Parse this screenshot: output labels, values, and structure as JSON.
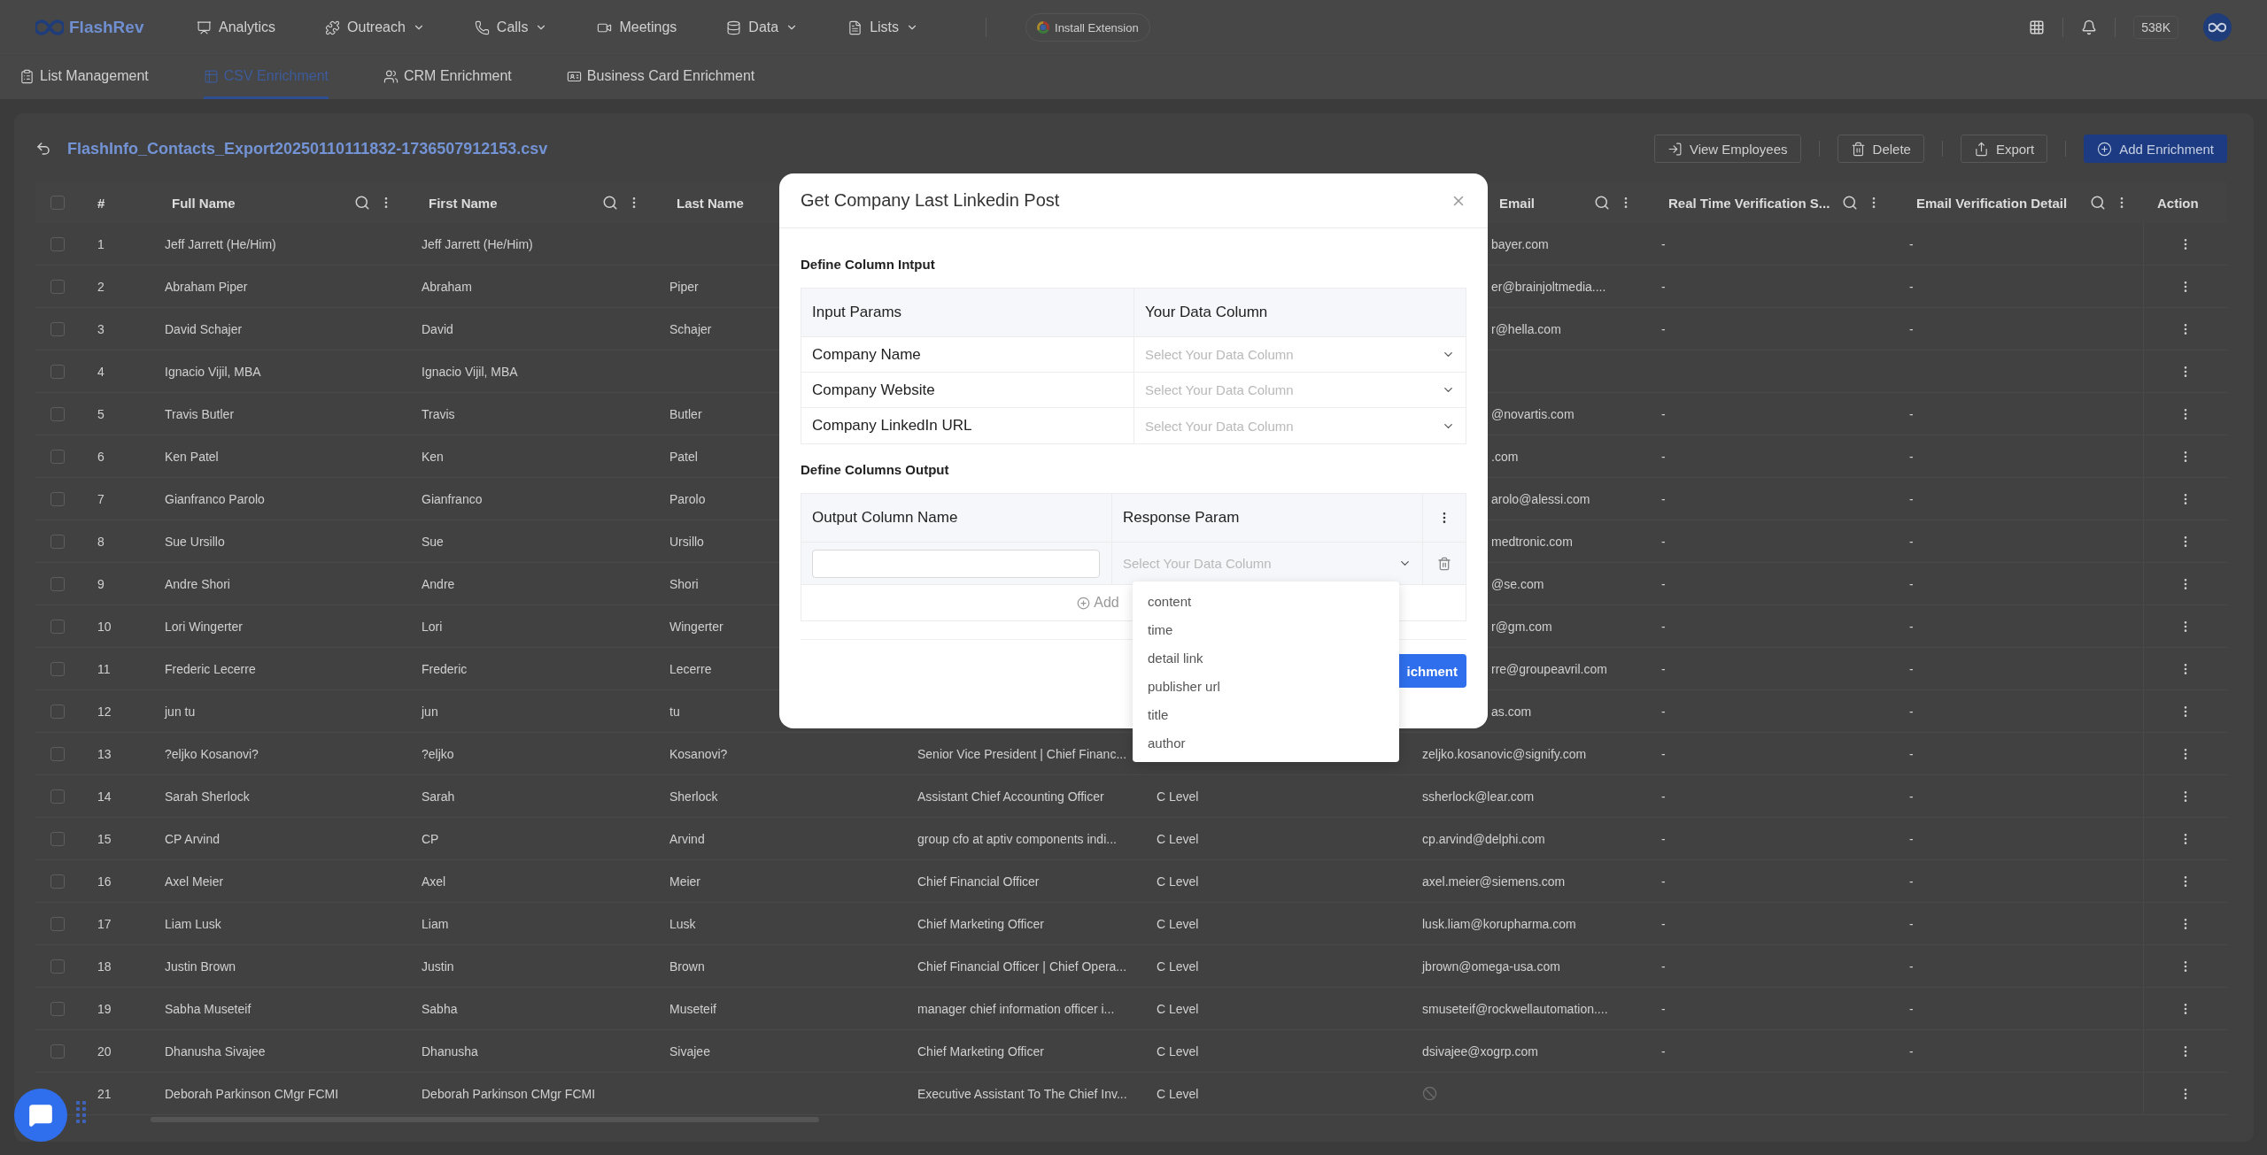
{
  "top_nav": {
    "logo": "FlashRev",
    "items": [
      {
        "label": "Analytics",
        "menu": false
      },
      {
        "label": "Outreach",
        "menu": true
      },
      {
        "label": "Calls",
        "menu": true
      },
      {
        "label": "Meetings",
        "menu": false
      },
      {
        "label": "Data",
        "menu": true
      },
      {
        "label": "Lists",
        "menu": true
      }
    ],
    "extension_button": "Install Extension",
    "credits": "538K"
  },
  "sub_tabs": [
    {
      "label": "List Management",
      "selected": false
    },
    {
      "label": "CSV Enrichment",
      "selected": true
    },
    {
      "label": "CRM Enrichment",
      "selected": false
    },
    {
      "label": "Business Card Enrichment",
      "selected": false
    }
  ],
  "file": {
    "title": "FlashInfo_Contacts_Export20250110111832-1736507912153.csv",
    "actions": [
      {
        "label": "View Employees",
        "kind": "outline"
      },
      {
        "label": "Delete",
        "kind": "outline"
      },
      {
        "label": "Export",
        "kind": "outline"
      },
      {
        "label": "Add Enrichment",
        "kind": "primary"
      }
    ]
  },
  "table": {
    "all_checked": false,
    "columns": [
      {
        "label": "#"
      },
      {
        "label": "Full Name",
        "tools": true
      },
      {
        "label": "First Name",
        "tools": true
      },
      {
        "label": "Last Name"
      },
      {
        "label": "Email",
        "tools": true
      },
      {
        "label": "Real Time Verification S...",
        "tools": true
      },
      {
        "label": "Email Verification Detail",
        "tools": true
      },
      {
        "label": "Action"
      }
    ],
    "rows": [
      {
        "checked": false,
        "no_email": false,
        "n": "1",
        "full_name": "Jeff Jarrett (He/Him)",
        "first_name": "Jeff Jarrett (He/Him)",
        "email": "bayer.com",
        "rtv": "-",
        "evd": "-"
      },
      {
        "checked": false,
        "no_email": false,
        "n": "2",
        "full_name": "Abraham Piper",
        "first_name": "Abraham",
        "last_name": "Piper",
        "email": "er@brainjoltmedia....",
        "rtv": "-",
        "evd": "-"
      },
      {
        "checked": false,
        "no_email": false,
        "n": "3",
        "full_name": "David Schajer",
        "first_name": "David",
        "last_name": "Schajer",
        "email": "r@hella.com",
        "rtv": "-",
        "evd": "-"
      },
      {
        "checked": false,
        "no_email": false,
        "n": "4",
        "full_name": "Ignacio Vijil, MBA",
        "first_name": "Ignacio Vijil, MBA"
      },
      {
        "checked": false,
        "no_email": false,
        "n": "5",
        "full_name": "Travis Butler",
        "first_name": "Travis",
        "last_name": "Butler",
        "email": "@novartis.com",
        "rtv": "-",
        "evd": "-"
      },
      {
        "checked": false,
        "no_email": false,
        "n": "6",
        "full_name": "Ken Patel",
        "first_name": "Ken",
        "last_name": "Patel",
        "email": ".com",
        "rtv": "-",
        "evd": "-"
      },
      {
        "checked": false,
        "no_email": false,
        "n": "7",
        "full_name": "Gianfranco Parolo",
        "first_name": "Gianfranco",
        "last_name": "Parolo",
        "email": "arolo@alessi.com",
        "rtv": "-",
        "evd": "-"
      },
      {
        "checked": false,
        "no_email": false,
        "n": "8",
        "full_name": "Sue Ursillo",
        "first_name": "Sue",
        "last_name": "Ursillo",
        "email": "medtronic.com",
        "rtv": "-",
        "evd": "-"
      },
      {
        "checked": false,
        "no_email": false,
        "n": "9",
        "full_name": "Andre Shori",
        "first_name": "Andre",
        "last_name": "Shori",
        "email": "@se.com",
        "rtv": "-",
        "evd": "-"
      },
      {
        "checked": false,
        "no_email": false,
        "n": "10",
        "full_name": "Lori Wingerter",
        "first_name": "Lori",
        "last_name": "Wingerter",
        "email": "r@gm.com",
        "rtv": "-",
        "evd": "-"
      },
      {
        "checked": false,
        "no_email": false,
        "n": "11",
        "full_name": "Frederic Lecerre",
        "first_name": "Frederic",
        "last_name": "Lecerre",
        "email": "rre@groupeavril.com",
        "rtv": "-",
        "evd": "-"
      },
      {
        "checked": false,
        "no_email": false,
        "n": "12",
        "full_name": "jun tu",
        "first_name": "jun",
        "last_name": "tu",
        "email": "as.com",
        "rtv": "-",
        "evd": "-"
      },
      {
        "checked": false,
        "no_email": false,
        "n": "13",
        "full_name": "?eljko Kosanovi?",
        "first_name": "?eljko",
        "last_name": "Kosanovi?",
        "job_title": "Senior Vice President | Chief Financ...",
        "email": "zeljko.kosanovic@signify.com",
        "rtv": "-",
        "evd": "-"
      },
      {
        "checked": false,
        "no_email": false,
        "n": "14",
        "full_name": "Sarah Sherlock",
        "first_name": "Sarah",
        "last_name": "Sherlock",
        "job_title": "Assistant Chief Accounting Officer",
        "level": "C Level",
        "email": "ssherlock@lear.com",
        "rtv": "-",
        "evd": "-"
      },
      {
        "checked": false,
        "no_email": false,
        "n": "15",
        "full_name": "CP Arvind",
        "first_name": "CP",
        "last_name": "Arvind",
        "job_title": "group cfo at aptiv components indi...",
        "level": "C Level",
        "email": "cp.arvind@delphi.com",
        "rtv": "-",
        "evd": "-"
      },
      {
        "checked": false,
        "no_email": false,
        "n": "16",
        "full_name": "Axel Meier",
        "first_name": "Axel",
        "last_name": "Meier",
        "job_title": "Chief Financial Officer",
        "level": "C Level",
        "email": "axel.meier@siemens.com",
        "rtv": "-",
        "evd": "-"
      },
      {
        "checked": false,
        "no_email": false,
        "n": "17",
        "full_name": "Liam Lusk",
        "first_name": "Liam",
        "last_name": "Lusk",
        "job_title": "Chief Marketing Officer",
        "level": "C Level",
        "email": "lusk.liam@korupharma.com",
        "rtv": "-",
        "evd": "-"
      },
      {
        "checked": false,
        "no_email": false,
        "n": "18",
        "full_name": "Justin Brown",
        "first_name": "Justin",
        "last_name": "Brown",
        "job_title": "Chief Financial Officer | Chief Opera...",
        "level": "C Level",
        "email": "jbrown@omega-usa.com",
        "rtv": "-",
        "evd": "-"
      },
      {
        "checked": false,
        "no_email": false,
        "n": "19",
        "full_name": "Sabha Museteif",
        "first_name": "Sabha",
        "last_name": "Museteif",
        "job_title": "manager chief information officer i...",
        "level": "C Level",
        "email": "smuseteif@rockwellautomation....",
        "rtv": "-",
        "evd": "-"
      },
      {
        "checked": false,
        "no_email": false,
        "n": "20",
        "full_name": "Dhanusha Sivajee",
        "first_name": "Dhanusha",
        "last_name": "Sivajee",
        "job_title": "Chief Marketing Officer",
        "level": "C Level",
        "email": "dsivajee@xogrp.com",
        "rtv": "-",
        "evd": "-"
      },
      {
        "no_email": true,
        "n": "21",
        "full_name": "Deborah Parkinson CMgr FCMI",
        "first_name": "Deborah Parkinson CMgr FCMI",
        "job_title": "Executive Assistant To The Chief Inv...",
        "level": "C Level"
      }
    ]
  },
  "modal": {
    "title": "Get Company Last Linkedin Post",
    "input_section": {
      "heading": "Define Column Intput",
      "columns": [
        "Input Params",
        "Your Data Column"
      ],
      "rows": [
        {
          "param": "Company Name",
          "placeholder": "Select Your Data Column"
        },
        {
          "param": "Company Website",
          "placeholder": "Select Your Data Column"
        },
        {
          "param": "Company LinkedIn URL",
          "placeholder": "Select Your Data Column"
        }
      ]
    },
    "output_section": {
      "heading": "Define Columns Output",
      "columns": [
        "Output Column Name",
        "Response Param"
      ],
      "rows": [
        {
          "placeholder": "Select Your Data Column"
        }
      ],
      "add_label": "Add"
    },
    "dropdown": {
      "options": [
        {
          "label": "content",
          "selected": false
        },
        {
          "label": "time",
          "selected": false
        },
        {
          "label": "detail link",
          "selected": false
        },
        {
          "label": "publisher url",
          "selected": false
        },
        {
          "label": "title",
          "selected": false
        },
        {
          "label": "author",
          "selected": false
        }
      ]
    },
    "submit_label": "ichment"
  }
}
